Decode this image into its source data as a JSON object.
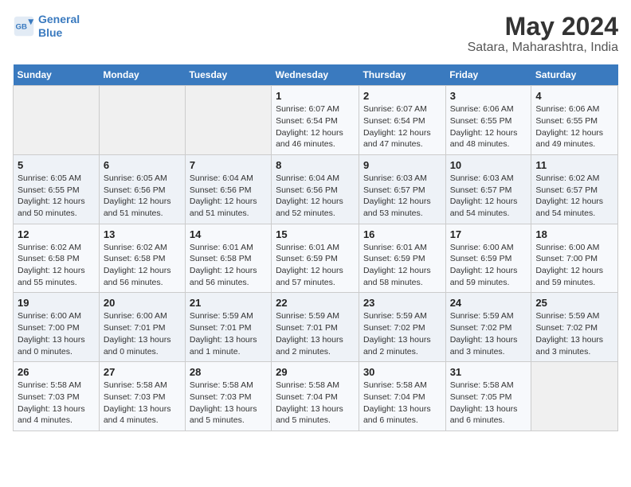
{
  "logo": {
    "line1": "General",
    "line2": "Blue"
  },
  "title": "May 2024",
  "subtitle": "Satara, Maharashtra, India",
  "days_of_week": [
    "Sunday",
    "Monday",
    "Tuesday",
    "Wednesday",
    "Thursday",
    "Friday",
    "Saturday"
  ],
  "weeks": [
    [
      {
        "day": "",
        "info": ""
      },
      {
        "day": "",
        "info": ""
      },
      {
        "day": "",
        "info": ""
      },
      {
        "day": "1",
        "info": "Sunrise: 6:07 AM\nSunset: 6:54 PM\nDaylight: 12 hours and 46 minutes."
      },
      {
        "day": "2",
        "info": "Sunrise: 6:07 AM\nSunset: 6:54 PM\nDaylight: 12 hours and 47 minutes."
      },
      {
        "day": "3",
        "info": "Sunrise: 6:06 AM\nSunset: 6:55 PM\nDaylight: 12 hours and 48 minutes."
      },
      {
        "day": "4",
        "info": "Sunrise: 6:06 AM\nSunset: 6:55 PM\nDaylight: 12 hours and 49 minutes."
      }
    ],
    [
      {
        "day": "5",
        "info": "Sunrise: 6:05 AM\nSunset: 6:55 PM\nDaylight: 12 hours and 50 minutes."
      },
      {
        "day": "6",
        "info": "Sunrise: 6:05 AM\nSunset: 6:56 PM\nDaylight: 12 hours and 51 minutes."
      },
      {
        "day": "7",
        "info": "Sunrise: 6:04 AM\nSunset: 6:56 PM\nDaylight: 12 hours and 51 minutes."
      },
      {
        "day": "8",
        "info": "Sunrise: 6:04 AM\nSunset: 6:56 PM\nDaylight: 12 hours and 52 minutes."
      },
      {
        "day": "9",
        "info": "Sunrise: 6:03 AM\nSunset: 6:57 PM\nDaylight: 12 hours and 53 minutes."
      },
      {
        "day": "10",
        "info": "Sunrise: 6:03 AM\nSunset: 6:57 PM\nDaylight: 12 hours and 54 minutes."
      },
      {
        "day": "11",
        "info": "Sunrise: 6:02 AM\nSunset: 6:57 PM\nDaylight: 12 hours and 54 minutes."
      }
    ],
    [
      {
        "day": "12",
        "info": "Sunrise: 6:02 AM\nSunset: 6:58 PM\nDaylight: 12 hours and 55 minutes."
      },
      {
        "day": "13",
        "info": "Sunrise: 6:02 AM\nSunset: 6:58 PM\nDaylight: 12 hours and 56 minutes."
      },
      {
        "day": "14",
        "info": "Sunrise: 6:01 AM\nSunset: 6:58 PM\nDaylight: 12 hours and 56 minutes."
      },
      {
        "day": "15",
        "info": "Sunrise: 6:01 AM\nSunset: 6:59 PM\nDaylight: 12 hours and 57 minutes."
      },
      {
        "day": "16",
        "info": "Sunrise: 6:01 AM\nSunset: 6:59 PM\nDaylight: 12 hours and 58 minutes."
      },
      {
        "day": "17",
        "info": "Sunrise: 6:00 AM\nSunset: 6:59 PM\nDaylight: 12 hours and 59 minutes."
      },
      {
        "day": "18",
        "info": "Sunrise: 6:00 AM\nSunset: 7:00 PM\nDaylight: 12 hours and 59 minutes."
      }
    ],
    [
      {
        "day": "19",
        "info": "Sunrise: 6:00 AM\nSunset: 7:00 PM\nDaylight: 13 hours and 0 minutes."
      },
      {
        "day": "20",
        "info": "Sunrise: 6:00 AM\nSunset: 7:01 PM\nDaylight: 13 hours and 0 minutes."
      },
      {
        "day": "21",
        "info": "Sunrise: 5:59 AM\nSunset: 7:01 PM\nDaylight: 13 hours and 1 minute."
      },
      {
        "day": "22",
        "info": "Sunrise: 5:59 AM\nSunset: 7:01 PM\nDaylight: 13 hours and 2 minutes."
      },
      {
        "day": "23",
        "info": "Sunrise: 5:59 AM\nSunset: 7:02 PM\nDaylight: 13 hours and 2 minutes."
      },
      {
        "day": "24",
        "info": "Sunrise: 5:59 AM\nSunset: 7:02 PM\nDaylight: 13 hours and 3 minutes."
      },
      {
        "day": "25",
        "info": "Sunrise: 5:59 AM\nSunset: 7:02 PM\nDaylight: 13 hours and 3 minutes."
      }
    ],
    [
      {
        "day": "26",
        "info": "Sunrise: 5:58 AM\nSunset: 7:03 PM\nDaylight: 13 hours and 4 minutes."
      },
      {
        "day": "27",
        "info": "Sunrise: 5:58 AM\nSunset: 7:03 PM\nDaylight: 13 hours and 4 minutes."
      },
      {
        "day": "28",
        "info": "Sunrise: 5:58 AM\nSunset: 7:03 PM\nDaylight: 13 hours and 5 minutes."
      },
      {
        "day": "29",
        "info": "Sunrise: 5:58 AM\nSunset: 7:04 PM\nDaylight: 13 hours and 5 minutes."
      },
      {
        "day": "30",
        "info": "Sunrise: 5:58 AM\nSunset: 7:04 PM\nDaylight: 13 hours and 6 minutes."
      },
      {
        "day": "31",
        "info": "Sunrise: 5:58 AM\nSunset: 7:05 PM\nDaylight: 13 hours and 6 minutes."
      },
      {
        "day": "",
        "info": ""
      }
    ]
  ]
}
